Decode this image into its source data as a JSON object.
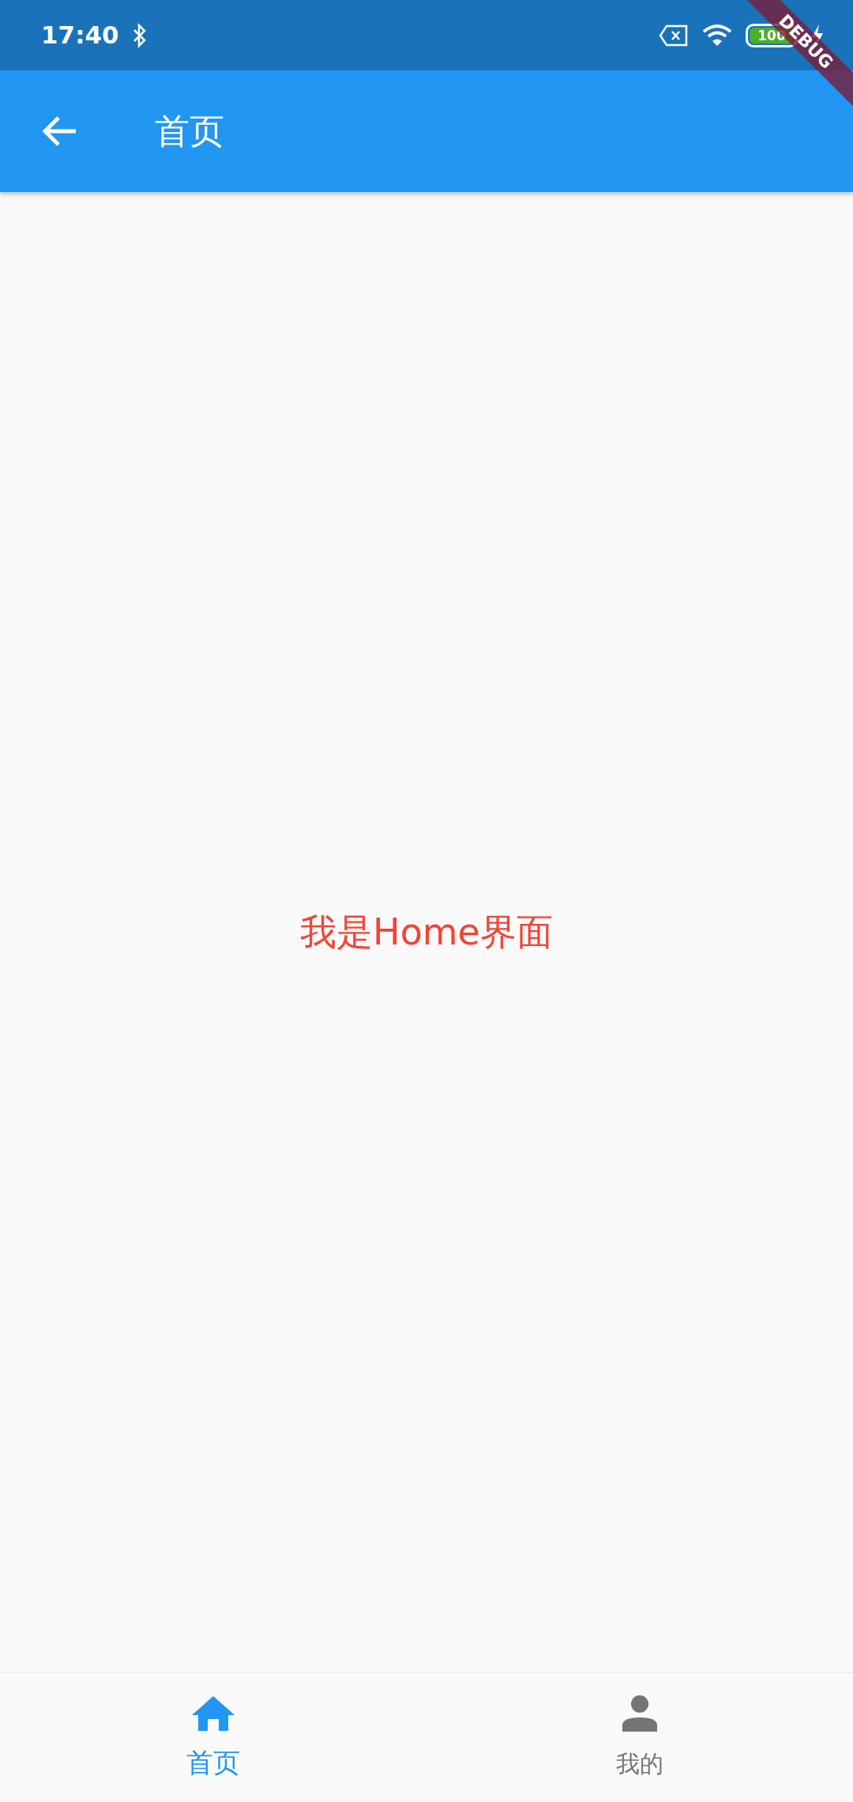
{
  "status_bar": {
    "time": "17:40",
    "battery": "100"
  },
  "app_bar": {
    "title": "首页"
  },
  "body": {
    "message": "我是Home界面"
  },
  "bottom_nav": [
    {
      "label": "首页",
      "kind": "home",
      "selected": true
    },
    {
      "label": "我的",
      "kind": "person",
      "selected": false
    }
  ],
  "debug_banner": "DEBUG"
}
